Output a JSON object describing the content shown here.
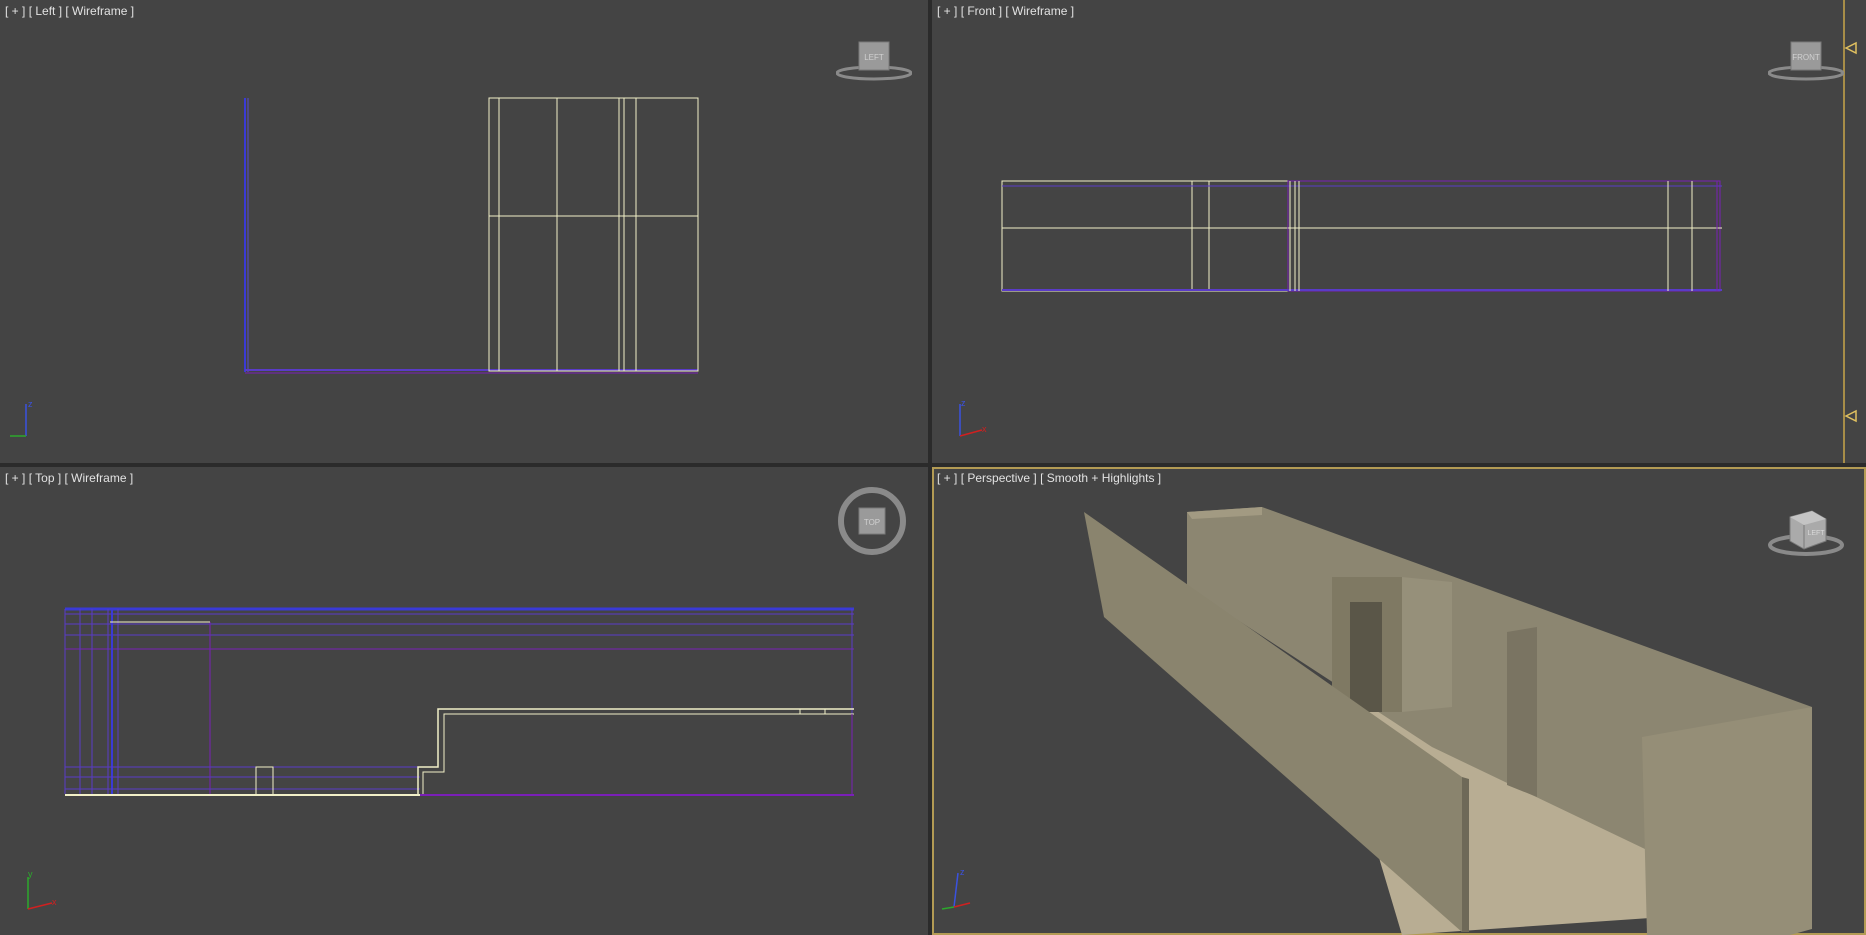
{
  "viewports": {
    "left": {
      "plus": "[ + ]",
      "view": "[ Left ]",
      "shading": "[ Wireframe ]",
      "cube_text": "LEFT"
    },
    "front": {
      "plus": "[ + ]",
      "view": "[ Front ]",
      "shading": "[ Wireframe ]",
      "cube_text": "FRONT"
    },
    "top": {
      "plus": "[ + ]",
      "view": "[ Top ]",
      "shading": "[ Wireframe ]",
      "cube_text": "TOP"
    },
    "perspective": {
      "plus": "[ + ]",
      "view": "[ Perspective ]",
      "shading": "[ Smooth + Highlights ]",
      "cube_text": "LEFT"
    }
  },
  "axes": {
    "x": "x",
    "y": "y",
    "z": "z"
  },
  "colors": {
    "viewport_bg": "#444444",
    "wire_white": "#f2f0c8",
    "wire_blue": "#3a3ad6",
    "wire_purple": "#7a1fb8",
    "active_border": "#b39b54",
    "wall": "#8c8671"
  }
}
